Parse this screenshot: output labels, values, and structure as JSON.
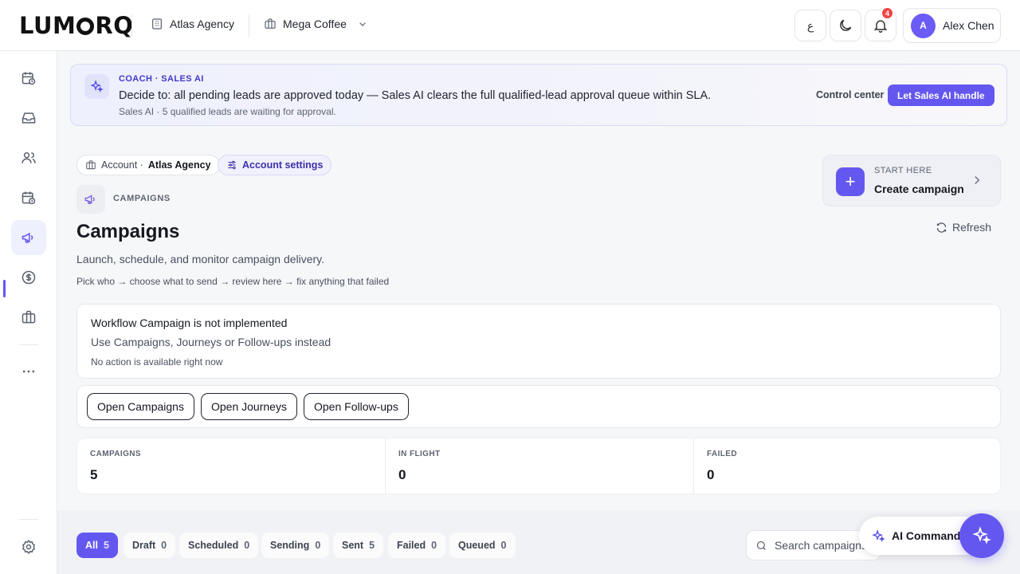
{
  "brand": {
    "logo_text_a": "LUM",
    "logo_text_b": "RQ"
  },
  "topbar": {
    "agency": "Atlas Agency",
    "client": "Mega Coffee",
    "lang_label": "ع",
    "notifications_count": "4",
    "user_initial": "A",
    "user_name": "Alex Chen"
  },
  "sidebar": {
    "items": [
      "calendar-clock-icon",
      "inbox-icon",
      "users-icon",
      "schedule-icon",
      "megaphone-icon",
      "dollar-icon",
      "briefcase-icon",
      "more-icon"
    ],
    "active": "megaphone-icon",
    "footer": "gear-icon"
  },
  "coach": {
    "tag": "COACH · SALES AI",
    "title": "Decide to: all pending leads are approved today — Sales AI clears the full qualified-lead approval queue within SLA.",
    "subtitle": "Sales AI · 5 qualified leads are waiting for approval.",
    "link": "Control center",
    "cta": "Let Sales AI handle"
  },
  "account": {
    "label": "Account ·",
    "name": "Atlas Agency",
    "settings": "Account settings"
  },
  "section": {
    "label": "CAMPAIGNS",
    "title": "Campaigns",
    "subtitle": "Launch, schedule, and monitor campaign delivery.",
    "hint": "Pick who → choose what to send → review here → fix anything that failed"
  },
  "start": {
    "kicker": "START HERE",
    "title": "Create campaign"
  },
  "refresh": "Refresh",
  "notice": {
    "title": "Workflow Campaign is not implemented",
    "subtitle": "Use Campaigns, Journeys or Follow-ups instead",
    "note": "No action is available right now"
  },
  "actions": [
    "Open Campaigns",
    "Open Journeys",
    "Open Follow-ups"
  ],
  "stats": [
    {
      "label": "CAMPAIGNS",
      "value": "5"
    },
    {
      "label": "IN FLIGHT",
      "value": "0"
    },
    {
      "label": "FAILED",
      "value": "0"
    }
  ],
  "filters": [
    {
      "label": "All",
      "count": "5",
      "active": true
    },
    {
      "label": "Draft",
      "count": "0"
    },
    {
      "label": "Scheduled",
      "count": "0"
    },
    {
      "label": "Sending",
      "count": "0"
    },
    {
      "label": "Sent",
      "count": "5"
    },
    {
      "label": "Failed",
      "count": "0"
    },
    {
      "label": "Queued",
      "count": "0"
    }
  ],
  "search": {
    "placeholder": "Search campaigns"
  },
  "ai_command": "AI Command",
  "colors": {
    "accent": "#6457f0",
    "danger": "#ef4444"
  }
}
